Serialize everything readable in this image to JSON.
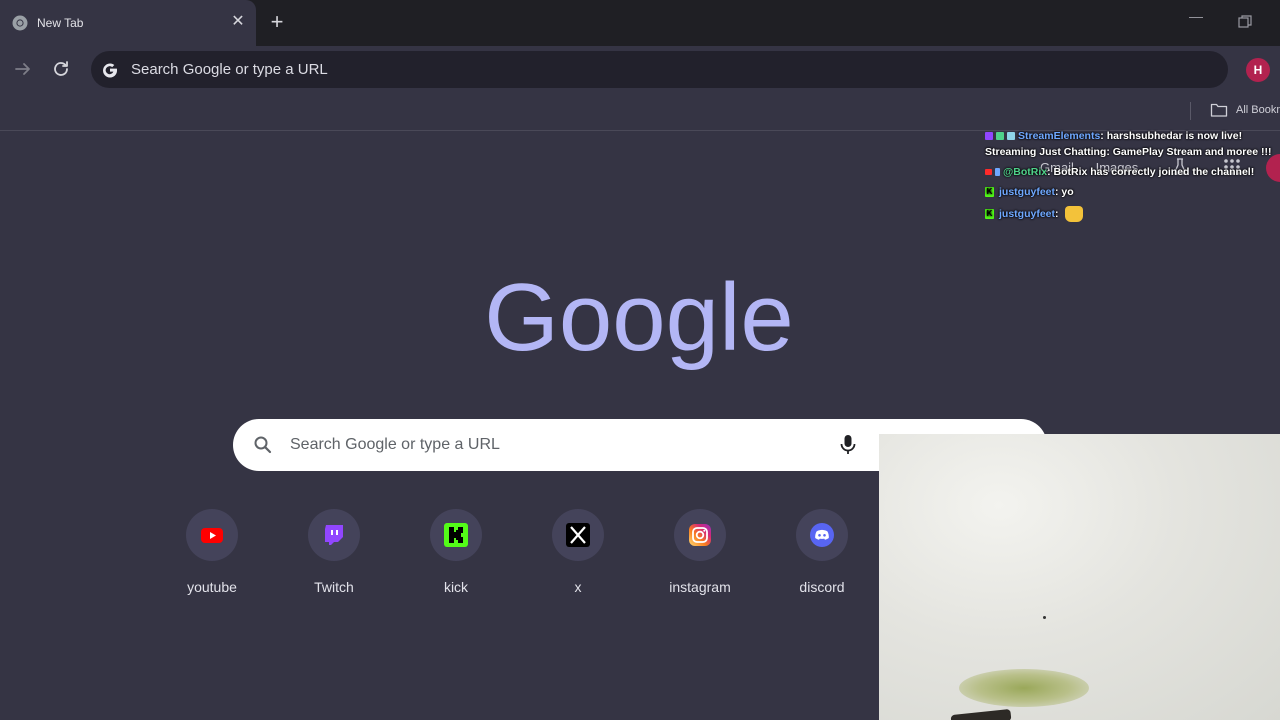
{
  "browser": {
    "tab": {
      "title": "New Tab",
      "close_glyph": "✕"
    },
    "new_tab_glyph": "+",
    "window": {
      "minimize_glyph": "—"
    },
    "omnibox": {
      "placeholder": "Search Google or type a URL"
    },
    "profile_initial": "H",
    "bookmarks_bar": {
      "all_bookmarks_label": "All Bookmarks"
    }
  },
  "ntp": {
    "header_links": [
      "Gmail",
      "Images"
    ],
    "logo_text": "Google",
    "search": {
      "placeholder": "Search Google or type a URL"
    },
    "shortcuts": [
      {
        "label": "youtube",
        "icon": "youtube-icon",
        "color": "#ff0000"
      },
      {
        "label": "Twitch",
        "icon": "twitch-icon",
        "color": "#9146ff"
      },
      {
        "label": "kick",
        "icon": "kick-icon",
        "color": "#53fc18"
      },
      {
        "label": "x",
        "icon": "x-icon",
        "color": "#000000"
      },
      {
        "label": "instagram",
        "icon": "instagram-icon",
        "color": "#e1306c"
      },
      {
        "label": "discord",
        "icon": "discord-icon",
        "color": "#5865f2"
      }
    ]
  },
  "chat": {
    "lines": [
      {
        "user": "StreamElements",
        "message": ": harshsubhedar is now live! Streaming Just Chatting: GamePlay Stream and moree !!!"
      },
      {
        "user": "@BotRix",
        "message": ": BotRix has correctly joined the channel!"
      },
      {
        "user": "justguyfeet",
        "message": ": yo"
      },
      {
        "user": "justguyfeet",
        "message": ":"
      }
    ]
  },
  "colors": {
    "page_bg": "#353444",
    "logo": "#b3b6f5",
    "avatar": "#b2224f"
  }
}
